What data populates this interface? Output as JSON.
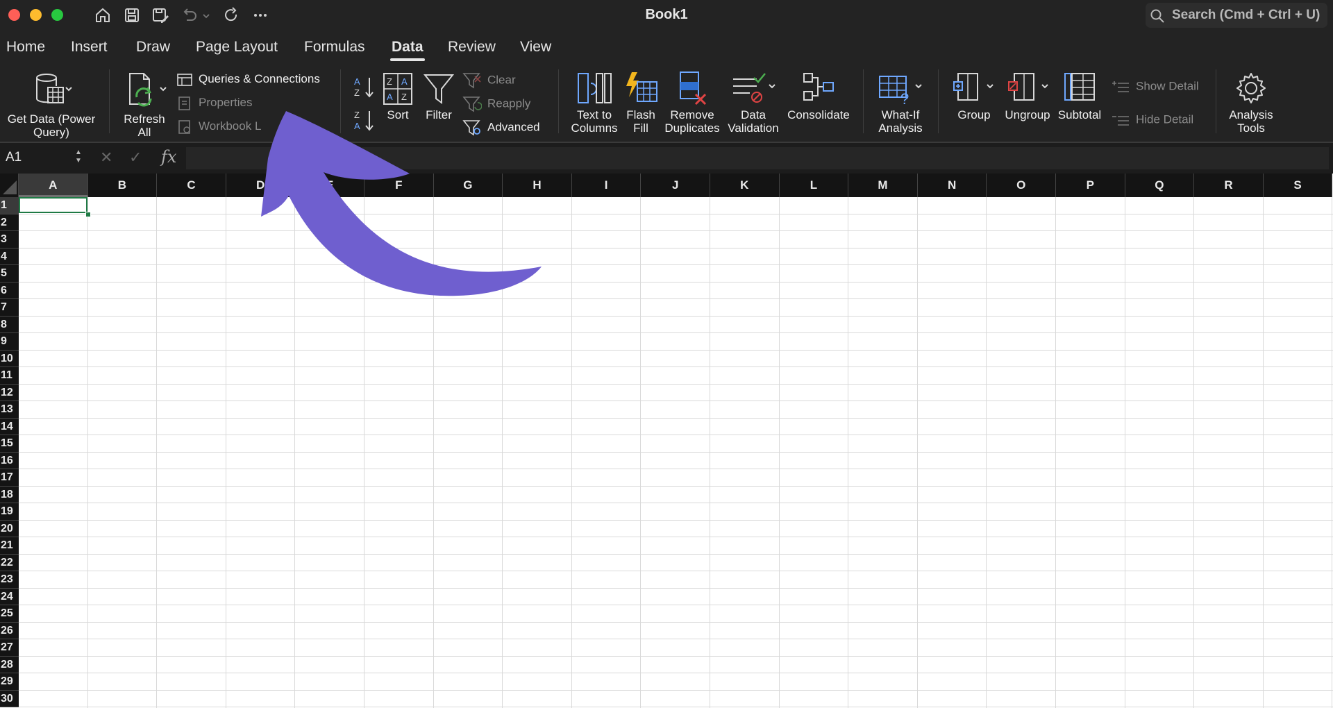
{
  "window": {
    "title": "Book1",
    "search_placeholder": "Search (Cmd + Ctrl + U)",
    "traffic_colors": {
      "close": "#ff5f57",
      "minimize": "#febc2e",
      "zoom": "#28c840"
    }
  },
  "menu_tabs": [
    {
      "label": "Home"
    },
    {
      "label": "Insert"
    },
    {
      "label": "Draw"
    },
    {
      "label": "Page Layout"
    },
    {
      "label": "Formulas"
    },
    {
      "label": "Data",
      "active": true
    },
    {
      "label": "Review"
    },
    {
      "label": "View"
    }
  ],
  "ribbon": {
    "get_data": "Get Data (Power Query)",
    "get_data_l1": "Get Data (Power",
    "get_data_l2": "Query)",
    "refresh_l1": "Refresh",
    "refresh_l2": "All",
    "queries_connections": "Queries & Connections",
    "properties": "Properties",
    "workbook_links": "Workbook L",
    "sort": "Sort",
    "filter": "Filter",
    "clear": "Clear",
    "reapply": "Reapply",
    "advanced": "Advanced",
    "text_to_columns_l1": "Text to",
    "text_to_columns_l2": "Columns",
    "flash_fill_l1": "Flash",
    "flash_fill_l2": "Fill",
    "remove_duplicates_l1": "Remove",
    "remove_duplicates_l2": "Duplicates",
    "data_validation_l1": "Data",
    "data_validation_l2": "Validation",
    "consolidate": "Consolidate",
    "what_if_l1": "What-If",
    "what_if_l2": "Analysis",
    "group": "Group",
    "ungroup": "Ungroup",
    "subtotal": "Subtotal",
    "show_detail": "Show Detail",
    "hide_detail": "Hide Detail",
    "analysis_tools_l1": "Analysis",
    "analysis_tools_l2": "Tools"
  },
  "formula_bar": {
    "name_box": "A1",
    "fx_label": "fx",
    "formula": ""
  },
  "sheet": {
    "columns": [
      "A",
      "B",
      "C",
      "D",
      "E",
      "F",
      "G",
      "H",
      "I",
      "J",
      "K",
      "L",
      "M",
      "N",
      "O",
      "P",
      "Q",
      "R",
      "S"
    ],
    "rows": [
      "1",
      "2",
      "3",
      "4",
      "5",
      "6",
      "7",
      "8",
      "9",
      "10",
      "11",
      "12",
      "13",
      "14",
      "15",
      "16",
      "17",
      "18",
      "19",
      "20",
      "21",
      "22",
      "23",
      "24",
      "25",
      "26",
      "27",
      "28",
      "29",
      "30"
    ],
    "active_cell": "A1",
    "active_cell_color": "#1f7a45"
  },
  "annotation": {
    "arrow_color": "#6f5fcf"
  }
}
